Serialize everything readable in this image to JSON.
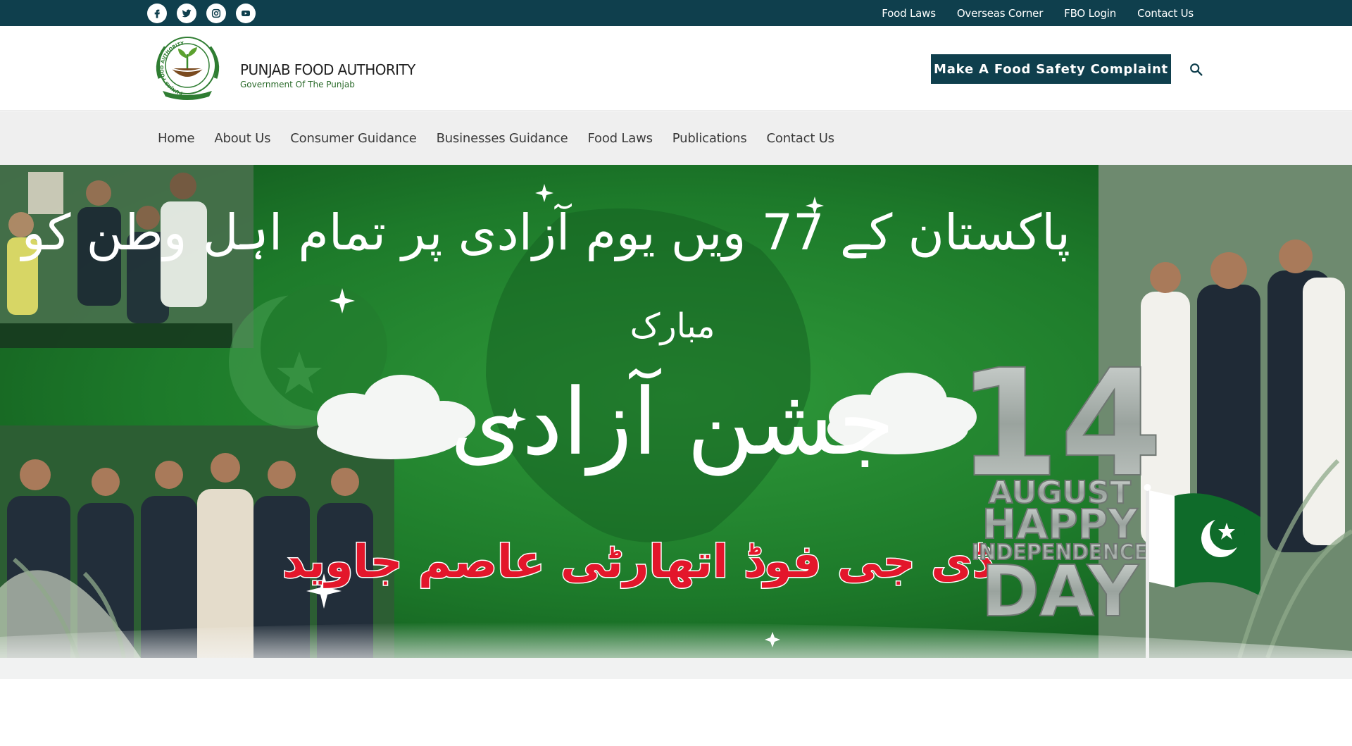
{
  "topbar": {
    "social": [
      {
        "icon": "facebook-icon"
      },
      {
        "icon": "twitter-icon"
      },
      {
        "icon": "instagram-icon"
      },
      {
        "icon": "youtube-icon"
      }
    ],
    "links": [
      "Food Laws",
      "Overseas Corner",
      "FBO Login",
      "Contact Us"
    ]
  },
  "header": {
    "brand_name": "PUNJAB FOOD AUTHORITY",
    "brand_sub": "Government Of The Punjab",
    "logo_ring_text": "PUNJAB FOOD AUTHORITY",
    "complaint_label": "Make A Food Safety Complaint"
  },
  "nav": {
    "items": [
      "Home",
      "About Us",
      "Consumer Guidance",
      "Businesses Guidance",
      "Food Laws",
      "Publications",
      "Contact Us"
    ]
  },
  "banner": {
    "headline_urdu": "پاکستان کے 77 ویں یوم آزادی پر تمام اہل وطن کو",
    "center_urdu": "جشن آزادی",
    "mubarak_urdu": "مبارک",
    "dg_urdu": "ڈی جی فوڈ اتھارٹی عاصم جاوید",
    "badge_number": "14",
    "badge_month": "AUGUST",
    "badge_happy": "HAPPY",
    "badge_independence": "INDEPENDENCE",
    "badge_day": "DAY"
  },
  "colors": {
    "brand_dark": "#0f3f4d",
    "banner_green": "#1f7a2c",
    "accent_red": "#e3162b"
  }
}
